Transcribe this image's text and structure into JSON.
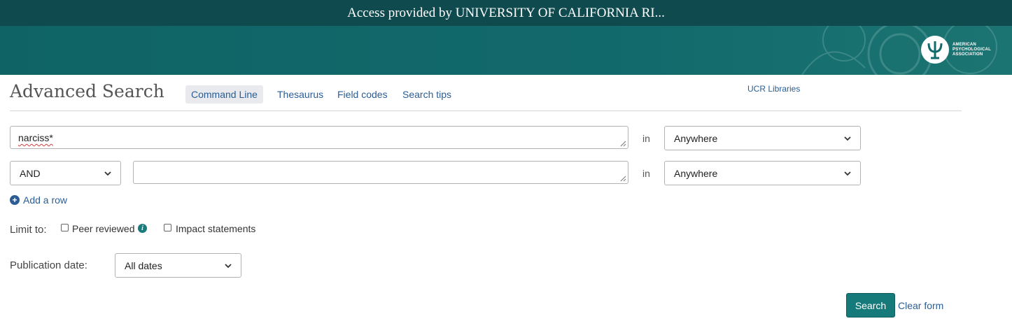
{
  "access_bar": {
    "text": "Access provided by UNIVERSITY OF CALIFORNIA RI..."
  },
  "banner": {
    "logo_text": "AMERICAN PSYCHOLOGICAL ASSOCIATION"
  },
  "header": {
    "title": "Advanced Search",
    "tabs": [
      {
        "label": "Command Line",
        "active": true
      },
      {
        "label": "Thesaurus",
        "active": false
      },
      {
        "label": "Field codes",
        "active": false
      },
      {
        "label": "Search tips",
        "active": false
      }
    ],
    "institution_link": "UCR Libraries"
  },
  "search_rows": [
    {
      "query": "narciss*",
      "in_label": "in",
      "field": "Anywhere"
    },
    {
      "operator": "AND",
      "query": "",
      "in_label": "in",
      "field": "Anywhere"
    }
  ],
  "add_row": {
    "label": "Add a row"
  },
  "limits": {
    "label": "Limit to:",
    "options": [
      {
        "label": "Peer reviewed",
        "checked": false
      },
      {
        "label": "Impact statements",
        "checked": false
      }
    ]
  },
  "publication_date": {
    "label": "Publication date:",
    "value": "All dates"
  },
  "actions": {
    "search_label": "Search",
    "clear_label": "Clear form"
  },
  "colors": {
    "access_bar": "#0f4a4f",
    "banner": "#12696b",
    "link": "#2b5d94",
    "button": "#167a7a"
  }
}
